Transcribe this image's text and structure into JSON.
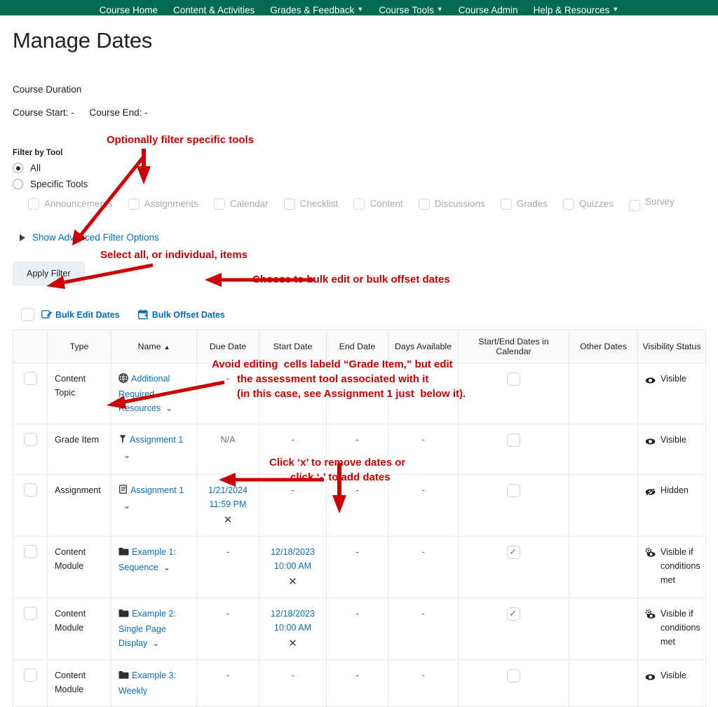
{
  "nav": {
    "items": [
      {
        "label": "Course Home",
        "caret": false
      },
      {
        "label": "Content & Activities",
        "caret": false
      },
      {
        "label": "Grades & Feedback",
        "caret": true
      },
      {
        "label": "Course Tools",
        "caret": true
      },
      {
        "label": "Course Admin",
        "caret": false
      },
      {
        "label": "Help & Resources",
        "caret": true
      }
    ],
    "caret_glyph": "▼",
    "bar_color": "#006B4F"
  },
  "page": {
    "title": "Manage Dates",
    "course_duration_label": "Course Duration",
    "course_start_label": "Course Start:",
    "course_start_value": "-",
    "course_end_label": "Course End:",
    "course_end_value": "-"
  },
  "filter": {
    "legend": "Filter by Tool",
    "radios": [
      {
        "label": "All",
        "checked": true
      },
      {
        "label": "Specific Tools",
        "checked": false
      }
    ],
    "tools": [
      {
        "label": "Announcements",
        "checked": false
      },
      {
        "label": "Assignments",
        "checked": false
      },
      {
        "label": "Calendar",
        "checked": false
      },
      {
        "label": "Checklist",
        "checked": false
      },
      {
        "label": "Content",
        "checked": false
      },
      {
        "label": "Discussions",
        "checked": false
      },
      {
        "label": "Grades",
        "checked": false
      },
      {
        "label": "Quizzes",
        "checked": false
      },
      {
        "label": "Survey",
        "checked": false
      }
    ],
    "advanced_label": "Show Advanced Filter Options",
    "apply_label": "Apply Filter"
  },
  "bulk": {
    "select_all_checked": false,
    "edit_label": "Bulk Edit Dates",
    "offset_label": "Bulk Offset Dates"
  },
  "table": {
    "columns": [
      "",
      "Type",
      "Name",
      "Due Date",
      "Start Date",
      "End Date",
      "Days Available",
      "Start/End Dates in Calendar",
      "Other Dates",
      "Visibility Status"
    ],
    "name_sort_caret": "▲",
    "rows": [
      {
        "selected": false,
        "type": "Content Topic",
        "name": "Additional Required Resources",
        "name_icon": "globe-icon",
        "has_chevron": true,
        "due_date": "-",
        "due_is_link": true,
        "due_has_x": false,
        "start_date": "-",
        "start_is_link": true,
        "start_has_x": false,
        "end_date": "-",
        "end_is_link": true,
        "days_available": "-",
        "calendar_checked": false,
        "other_dates": "",
        "visibility": "Visible",
        "visibility_icon": "eye-icon"
      },
      {
        "selected": false,
        "type": "Grade Item",
        "name": "Assignment 1",
        "name_icon": "grade-item-icon",
        "has_chevron": true,
        "due_date": "N/A",
        "due_is_link": false,
        "due_has_x": false,
        "start_date": "-",
        "start_is_link": true,
        "start_has_x": false,
        "end_date": "-",
        "end_is_link": true,
        "days_available": "-",
        "calendar_checked": false,
        "other_dates": "",
        "visibility": "Visible",
        "visibility_icon": "eye-icon"
      },
      {
        "selected": false,
        "type": "Assignment",
        "name": "Assignment 1",
        "name_icon": "assignment-icon",
        "has_chevron": true,
        "due_date": "1/21/2024 11:59 PM",
        "due_is_link": true,
        "due_has_x": true,
        "start_date": "-",
        "start_is_link": true,
        "start_has_x": false,
        "end_date": "-",
        "end_is_link": true,
        "days_available": "-",
        "calendar_checked": false,
        "other_dates": "",
        "visibility": "Hidden",
        "visibility_icon": "eye-slash-icon"
      },
      {
        "selected": false,
        "type": "Content Module",
        "name": "Example 1: Sequence",
        "name_icon": "folder-icon",
        "has_chevron": true,
        "due_date": "-",
        "due_is_link": true,
        "due_has_x": false,
        "start_date": "12/18/2023 10:00 AM",
        "start_is_link": true,
        "start_has_x": true,
        "end_date": "-",
        "end_is_link": true,
        "days_available": "-",
        "calendar_checked": true,
        "other_dates": "",
        "visibility": "Visible if conditions met",
        "visibility_icon": "conditional-eye-icon"
      },
      {
        "selected": false,
        "type": "Content Module",
        "name": "Example 2: Single Page Display",
        "name_icon": "folder-icon",
        "has_chevron": true,
        "due_date": "-",
        "due_is_link": true,
        "due_has_x": false,
        "start_date": "12/18/2023 10:00 AM",
        "start_is_link": true,
        "start_has_x": true,
        "end_date": "-",
        "end_is_link": true,
        "days_available": "-",
        "calendar_checked": true,
        "other_dates": "",
        "visibility": "Visible if conditions met",
        "visibility_icon": "conditional-eye-icon"
      },
      {
        "selected": false,
        "type": "Content Module",
        "name": "Example 3: Weekly",
        "name_icon": "folder-icon",
        "has_chevron": false,
        "due_date": "-",
        "due_is_link": true,
        "due_has_x": false,
        "start_date": "-",
        "start_is_link": true,
        "start_has_x": false,
        "end_date": "-",
        "end_is_link": true,
        "days_available": "-",
        "calendar_checked": false,
        "other_dates": "",
        "visibility": "Visible",
        "visibility_icon": "eye-icon"
      }
    ]
  },
  "annotations": {
    "color": "#cc0000",
    "items": [
      {
        "id": "filter-tools",
        "text": "Optionally filter specific tools"
      },
      {
        "id": "select-items",
        "text": "Select all, or individual, items"
      },
      {
        "id": "bulk-choice",
        "text": "Choose to bulk edit or bulk offset dates"
      },
      {
        "id": "grade-item-note-l1",
        "text": "Avoid editing  cells labeld “Grade Item,” but edit"
      },
      {
        "id": "grade-item-note-l2",
        "text": "the assessment tool associated with it"
      },
      {
        "id": "grade-item-note-l3",
        "text": "(in this case, see Assignment 1 just  below it)."
      },
      {
        "id": "x-remove-l1",
        "text": "Click ‘x’ to remove dates or"
      },
      {
        "id": "x-remove-l2",
        "text": "click ‘-’ to add dates"
      }
    ]
  }
}
